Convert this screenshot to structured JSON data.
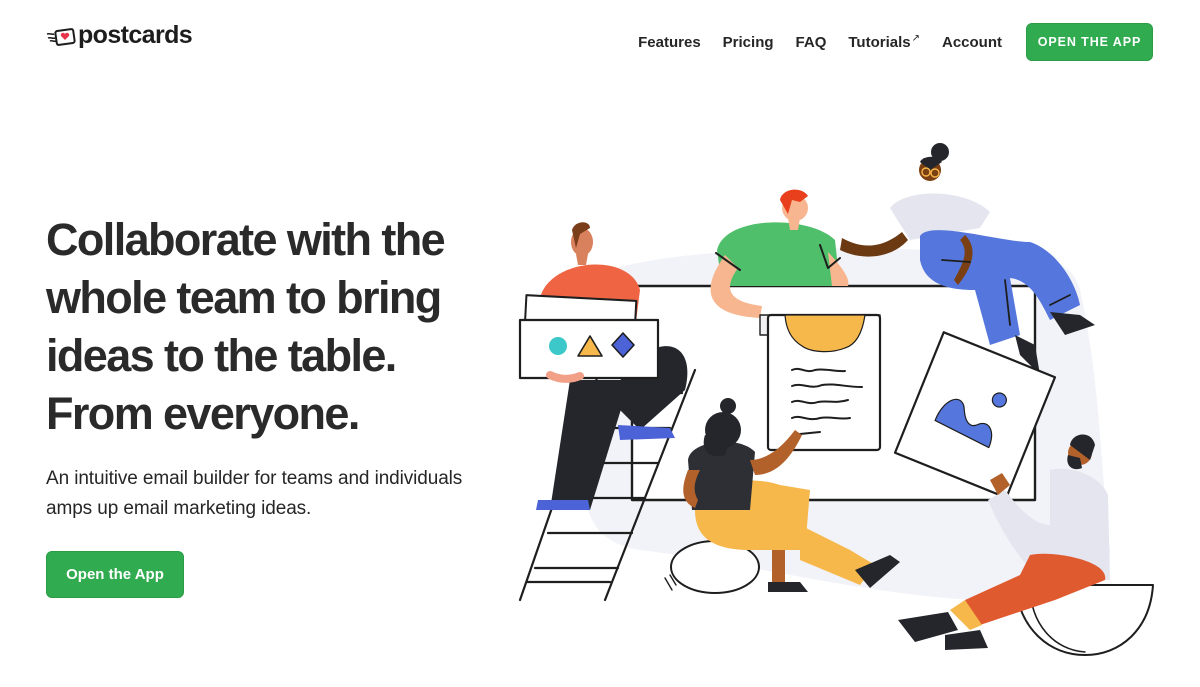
{
  "brand": {
    "name": "postcards",
    "logo_icon": "postcard-heart-icon",
    "accent_color": "#30ab4f",
    "heart_color": "#e6344a"
  },
  "nav": {
    "links": [
      {
        "label": "Features"
      },
      {
        "label": "Pricing"
      },
      {
        "label": "FAQ"
      },
      {
        "label": "Tutorials",
        "external_icon": "↗"
      },
      {
        "label": "Account"
      }
    ],
    "cta_label": "OPEN THE APP"
  },
  "hero": {
    "title_lines": [
      "Collaborate with the",
      "whole team to bring",
      "ideas to the table.",
      "From everyone."
    ],
    "subtitle_lines": [
      "An intuitive email builder for teams and individuals",
      "amps up email marketing ideas."
    ],
    "cta_label": "Open the App"
  },
  "illustration": {
    "description": "team-collaborating-around-board",
    "colors": {
      "green_shirt": "#4fbf6b",
      "orange_shirt": "#ef6544",
      "blue_pants": "#5577dd",
      "yellow": "#f6b74b",
      "dark": "#25262b",
      "light_bg": "#f2f3f8",
      "skin_light": "#f7b68f",
      "skin_dark": "#7a3f12",
      "skin_mid": "#b3612a",
      "red_hair": "#e8401c",
      "teal": "#3cc8c8"
    }
  }
}
